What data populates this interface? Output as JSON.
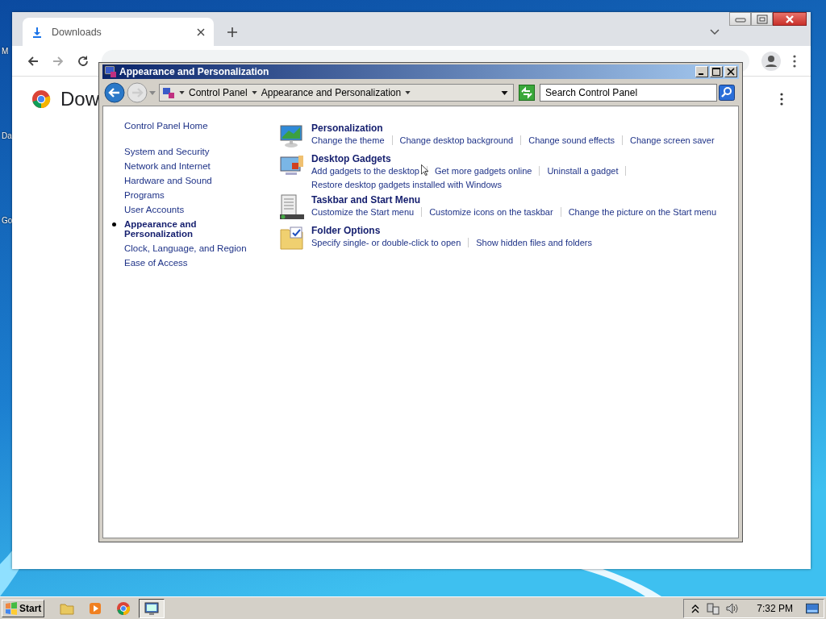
{
  "desktop": {
    "icon_labels": [
      "M",
      "Da",
      "Go"
    ]
  },
  "browser": {
    "tabs": [
      {
        "title": "Downloads",
        "selected": true
      }
    ],
    "page_heading": "Dow"
  },
  "control_panel": {
    "title": "Appearance and Personalization",
    "breadcrumb": [
      "Control Panel",
      "Appearance and Personalization"
    ],
    "search": {
      "placeholder": "Search Control Panel"
    },
    "nav": [
      {
        "label": "Control Panel Home",
        "selected": false,
        "kind": "home"
      },
      {
        "label": "System and Security",
        "selected": false,
        "kind": "category"
      },
      {
        "label": "Network and Internet",
        "selected": false,
        "kind": "category"
      },
      {
        "label": "Hardware and Sound",
        "selected": false,
        "kind": "category"
      },
      {
        "label": "Programs",
        "selected": false,
        "kind": "category"
      },
      {
        "label": "User Accounts",
        "selected": false,
        "kind": "category"
      },
      {
        "label": "Appearance and Personalization",
        "selected": true,
        "kind": "category"
      },
      {
        "label": "Clock, Language, and Region",
        "selected": false,
        "kind": "category"
      },
      {
        "label": "Ease of Access",
        "selected": false,
        "kind": "category"
      }
    ],
    "categories": [
      {
        "kind": "personalization",
        "title": "Personalization",
        "links": [
          "Change the theme",
          "Change desktop background",
          "Change sound effects",
          "Change screen saver"
        ]
      },
      {
        "kind": "gadgets",
        "title": "Desktop Gadgets",
        "links": [
          "Add gadgets to the desktop",
          "Get more gadgets online",
          "Uninstall a gadget",
          "Restore desktop gadgets installed with Windows"
        ]
      },
      {
        "kind": "taskbar",
        "title": "Taskbar and Start Menu",
        "links": [
          "Customize the Start menu",
          "Customize icons on the taskbar",
          "Change the picture on the Start menu"
        ]
      },
      {
        "kind": "folder",
        "title": "Folder Options",
        "links": [
          "Specify single- or double-click to open",
          "Show hidden files and folders"
        ]
      }
    ]
  },
  "taskbar": {
    "start": "Start",
    "apps": [
      {
        "kind": "explorer",
        "selected": false
      },
      {
        "kind": "media",
        "selected": false
      },
      {
        "kind": "browser",
        "selected": false
      },
      {
        "kind": "control-panel",
        "selected": true
      }
    ],
    "clock": "7:32 PM"
  }
}
